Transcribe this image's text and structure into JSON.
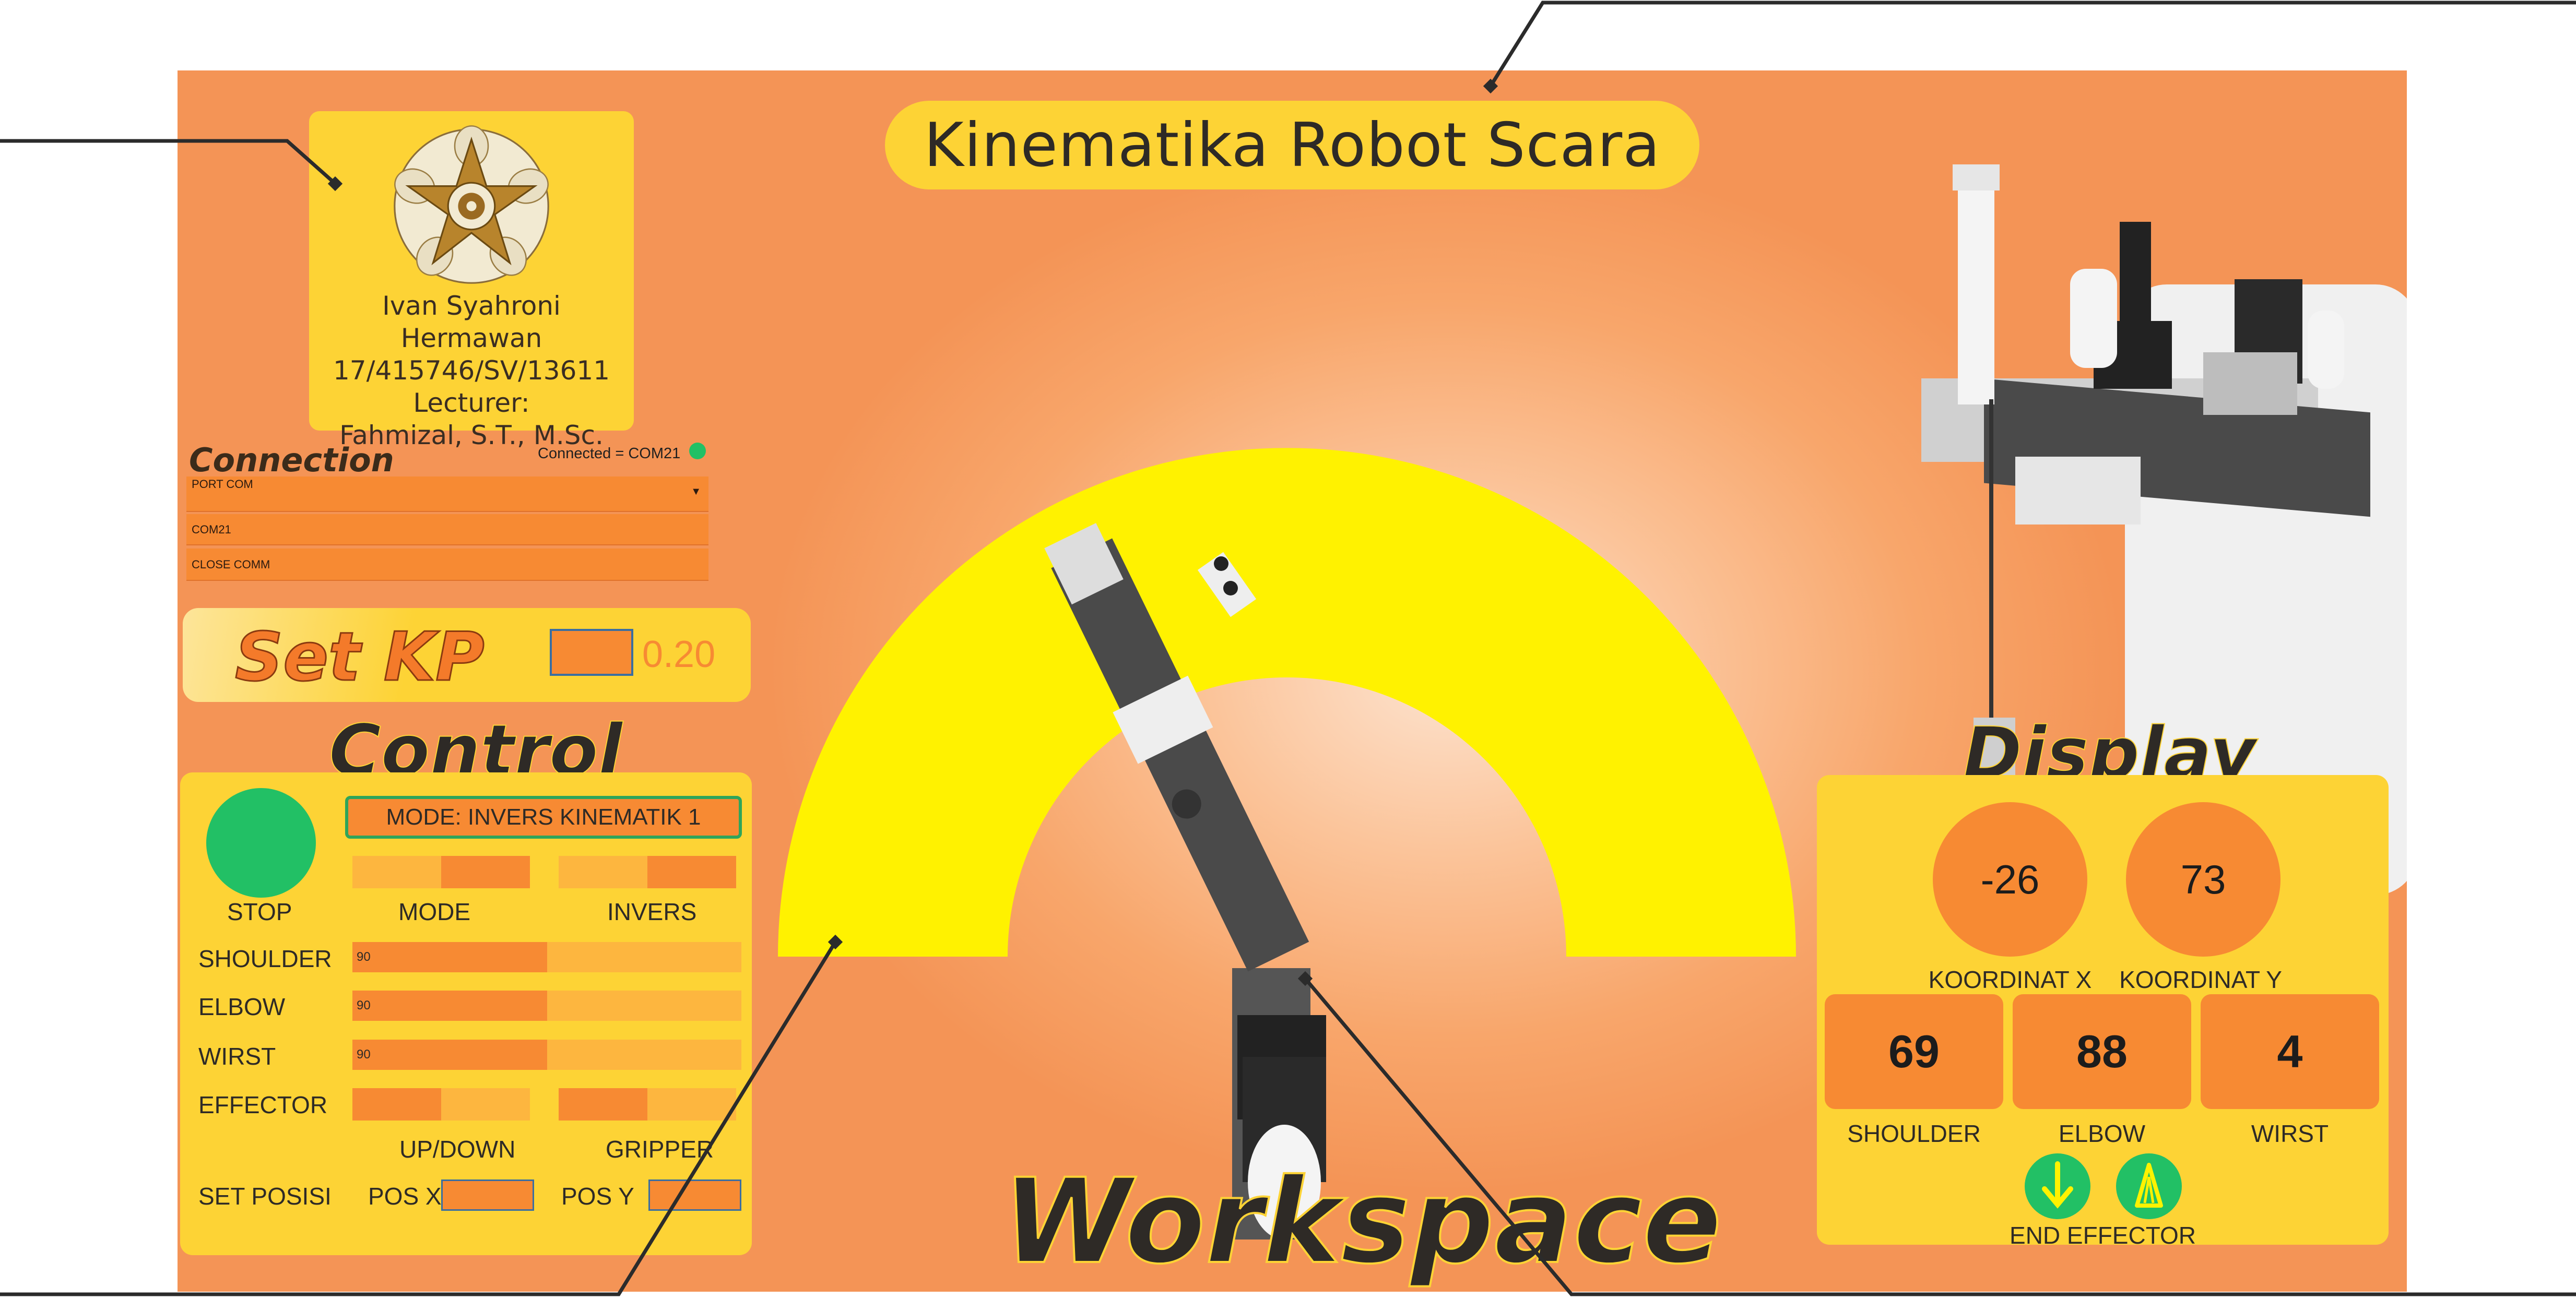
{
  "title": "Kinematika Robot Scara",
  "info": {
    "name": "Ivan Syahroni Hermawan",
    "student_id": "17/415746/SV/13611",
    "lecturer_label": "Lecturer:",
    "lecturer_name": "Fahmizal, S.T., M.Sc."
  },
  "connection": {
    "title": "Connection",
    "status": "Connected = COM21",
    "port_select": "PORT COM",
    "com_value": "COM21",
    "close_button": "CLOSE COMM"
  },
  "kp": {
    "label": "Set KP",
    "value": "0.20"
  },
  "control": {
    "title": "Control",
    "stop_label": "STOP",
    "mode_display": "MODE: INVERS KINEMATIK 1",
    "mode_label": "MODE",
    "invers_label": "INVERS",
    "shoulder_label": "SHOULDER",
    "elbow_label": "ELBOW",
    "wirst_label": "WIRST",
    "effector_label": "EFFECTOR",
    "shoulder_value": "90",
    "elbow_value": "90",
    "wirst_value": "90",
    "slider_fraction": 0.5,
    "updown_label": "UP/DOWN",
    "gripper_label": "GRIPPER",
    "set_posisi_label": "SET POSISI",
    "pos_x_label": "POS X",
    "pos_y_label": "POS Y"
  },
  "display": {
    "title": "Display",
    "koordinat_x": "-26",
    "koordinat_y": "73",
    "koordinat_x_label": "KOORDINAT X",
    "koordinat_y_label": "KOORDINAT Y",
    "shoulder": "69",
    "elbow": "88",
    "wirst": "4",
    "shoulder_label": "SHOULDER",
    "elbow_label": "ELBOW",
    "wirst_label": "WIRST",
    "end_effector_label": "END EFFECTOR"
  },
  "workspace_label": "Workspace",
  "colors": {
    "accent_yellow": "#fdd335",
    "accent_orange": "#f78a33",
    "status_green": "#22c065",
    "workspace_yellow": "#fff200"
  },
  "icons": {
    "logo": "university-emblem",
    "up_down": "arrow-down-icon",
    "gripper": "gripper-icon"
  }
}
